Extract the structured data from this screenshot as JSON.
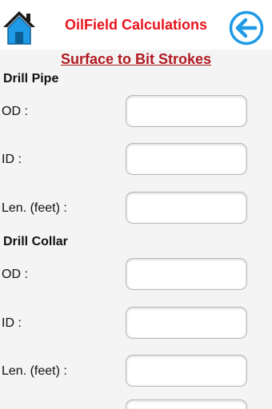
{
  "header": {
    "title": "OilField Calculations",
    "home_icon": "home-icon",
    "back_icon": "back-arrow-icon",
    "accent_color": "#e8141c",
    "icon_color": "#1e9ae6"
  },
  "page": {
    "title": "Surface to Bit Strokes"
  },
  "drill_pipe": {
    "heading": "Drill Pipe",
    "od_label": "OD :",
    "od_value": "",
    "id_label": "ID :",
    "id_value": "",
    "len_label": "Len. (feet) :",
    "len_value": ""
  },
  "drill_collar": {
    "heading": "Drill Collar",
    "od_label": "OD :",
    "od_value": "",
    "id_label": "ID :",
    "id_value": "",
    "len_label": "Len. (feet) :",
    "len_value": ""
  }
}
